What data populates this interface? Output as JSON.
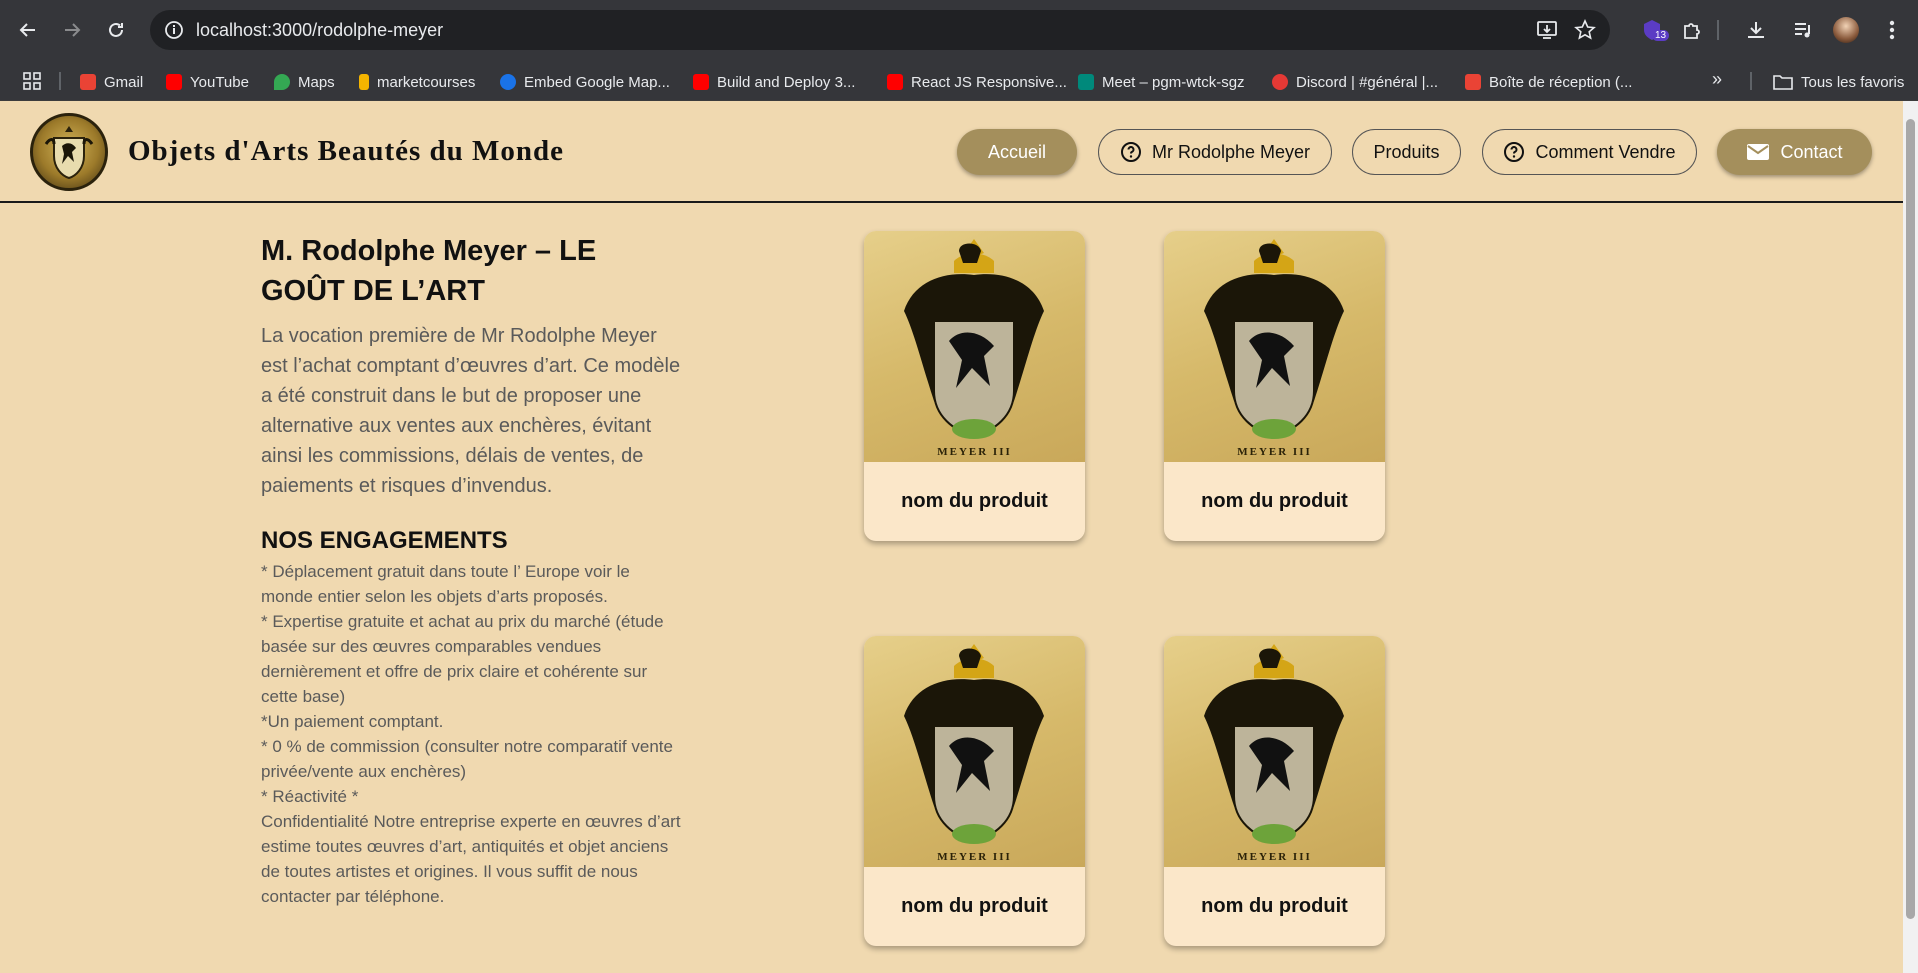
{
  "browser": {
    "url": "localhost:3000/rodolphe-meyer",
    "extension_badge": "13",
    "bookmarks": [
      {
        "label": "Gmail",
        "color": "#ea4335"
      },
      {
        "label": "YouTube",
        "color": "#ff0000"
      },
      {
        "label": "Maps",
        "color": "#34a853"
      },
      {
        "label": "marketcourses",
        "color": "#f4b400"
      },
      {
        "label": "Embed Google Map...",
        "color": "#1a73e8"
      },
      {
        "label": "Build and Deploy 3...",
        "color": "#ff0000"
      },
      {
        "label": "React JS Responsive...",
        "color": "#ff0000"
      },
      {
        "label": "Meet – pgm-wtck-sgz",
        "color": "#00897b"
      },
      {
        "label": "Discord | #général |...",
        "color": "#e53935"
      },
      {
        "label": "Boîte de réception (...",
        "color": "#ea4335"
      }
    ],
    "all_bookmarks": "Tous les favoris"
  },
  "site": {
    "title": "Objets d'Arts Beautés du Monde",
    "nav": {
      "home": "Accueil",
      "about": "Mr Rodolphe Meyer",
      "products": "Produits",
      "how_to_sell": "Comment Vendre",
      "contact": "Contact"
    },
    "accent_color": "#a48f5c",
    "background_color": "#f0d9b0"
  },
  "main": {
    "heading": "M. Rodolphe Meyer – LE GOÛT DE L’ART",
    "intro": "La vocation première de Mr Rodolphe Meyer est l’achat comptant d’œuvres d’art. Ce modèle a été construit dans le but de proposer une alternative aux ventes aux enchères, évitant ainsi les commissions, délais de ventes, de paiements et risques d’invendus.",
    "engagements_title": "NOS ENGAGEMENTS",
    "engagements_text": "* Déplacement gratuit dans toute l’ Europe voir le monde entier selon les objets d’arts proposés.\n* Expertise gratuite et achat au prix du marché (étude basée sur des œuvres comparables vendues dernièrement et offre de prix claire et cohérente sur cette base)\n*Un paiement comptant.\n* 0 % de commission (consulter notre comparatif vente privée/vente aux enchères)\n* Réactivité *\nConfidentialité Notre entreprise experte en œuvres d’art estime toutes œuvres d’art, antiquités et objet anciens de toutes artistes et origines. Il vous suffit de nous contacter par téléphone."
  },
  "products": [
    {
      "name": "nom du produit",
      "caption": "MEYER III"
    },
    {
      "name": "nom du produit",
      "caption": "MEYER III"
    },
    {
      "name": "nom du produit",
      "caption": "MEYER III"
    },
    {
      "name": "nom du produit",
      "caption": "MEYER III"
    }
  ]
}
